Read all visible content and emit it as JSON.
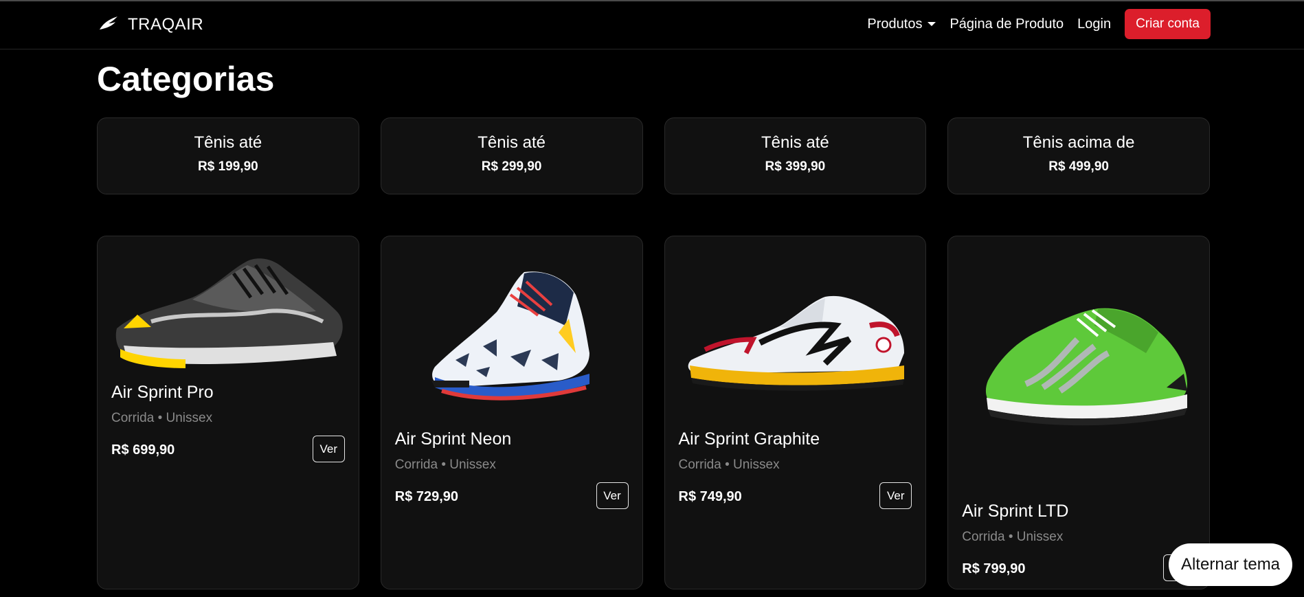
{
  "brand": {
    "name": "TRAQAIR",
    "icon": "bird-logo-icon"
  },
  "nav": {
    "products": "Produtos",
    "product_page": "Página de Produto",
    "login": "Login",
    "create_account": "Criar conta"
  },
  "colors": {
    "accent": "#dc1e2b",
    "background": "#000000",
    "card": "#111111"
  },
  "page_title": "Categorias",
  "categories": [
    {
      "title": "Tênis até",
      "price": "R$ 199,90"
    },
    {
      "title": "Tênis até",
      "price": "R$ 299,90"
    },
    {
      "title": "Tênis até",
      "price": "R$ 399,90"
    },
    {
      "title": "Tênis acima de",
      "price": "R$ 499,90"
    }
  ],
  "products": [
    {
      "name": "Air Sprint Pro",
      "meta": "Corrida • Unissex",
      "price": "R$ 699,90",
      "cta": "Ver",
      "image": "black-yellow-running-shoe"
    },
    {
      "name": "Air Sprint Neon",
      "meta": "Corrida • Unissex",
      "price": "R$ 729,90",
      "cta": "Ver",
      "image": "white-blue-running-shoe"
    },
    {
      "name": "Air Sprint Graphite",
      "meta": "Corrida • Unissex",
      "price": "R$ 749,90",
      "cta": "Ver",
      "image": "white-red-yellow-running-shoe"
    },
    {
      "name": "Air Sprint LTD",
      "meta": "Corrida • Unissex",
      "price": "R$ 799,90",
      "cta": "Ver",
      "image": "green-running-shoe"
    }
  ],
  "theme_toggle": "Alternar tema"
}
